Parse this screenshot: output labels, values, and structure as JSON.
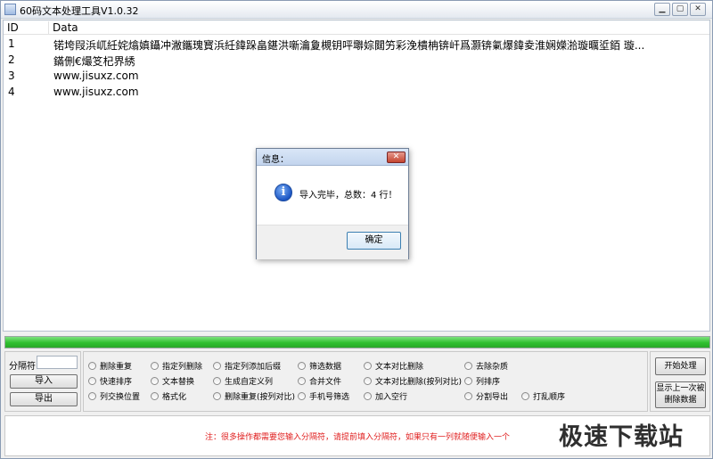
{
  "window": {
    "title": "60码文本处理工具V1.0.32",
    "minimize": "▁",
    "maximize": "▢",
    "close": "✕"
  },
  "grid": {
    "columns": [
      "ID",
      "Data"
    ],
    "rows": [
      {
        "id": "1",
        "data": "锘垮叚浜屼紝姹熻嫃鑷冲潎鑴瑰寳浜紝鍏跺畠鍖洪噺瀹夐槻钥呯壣婃閮竻彩浼樻柟锛屽爲灏锛氭爆鍏夌淮娴嬫湁璇曞垽銆     璇..."
      },
      {
        "id": "2",
        "data": "鏋侀€熶笅杞界綉"
      },
      {
        "id": "3",
        "data": "www.jisuxz.com"
      },
      {
        "id": "4",
        "data": "www.jisuxz.com"
      }
    ]
  },
  "progress": {
    "value": 1.0,
    "color": "#2fc02f"
  },
  "left_panel": {
    "separator_label": "分隔符",
    "separator_value": "",
    "import_label": "导入",
    "export_label": "导出"
  },
  "options": [
    [
      "删除重复",
      "指定列删除",
      "指定列添加后缀",
      "筛选数据",
      "文本对比删除",
      "去除杂质"
    ],
    [
      "快速排序",
      "文本替换",
      "生成自定义列",
      "合并文件",
      "文本对比删除(按列对比)",
      "列排序"
    ],
    [
      "列交换位置",
      "格式化",
      "删除重复(按列对比)",
      "手机号筛选",
      "加入空行",
      "分割导出",
      "打乱顺序"
    ]
  ],
  "right_panel": {
    "start_label": "开始处理",
    "last_delete_line1": "显示上一次被",
    "last_delete_line2": "删除数据"
  },
  "notice": {
    "text": "注：很多操作都需要您输入分隔符，请提前填入分隔符，如果只有一列就随便输入一个",
    "color": "#e02020"
  },
  "watermark": "极速下载站",
  "dialog": {
    "title": "信息：",
    "close": "✕",
    "message": "导入完毕，总数：4 行！",
    "ok_label": "确定",
    "icon": "info-icon"
  }
}
